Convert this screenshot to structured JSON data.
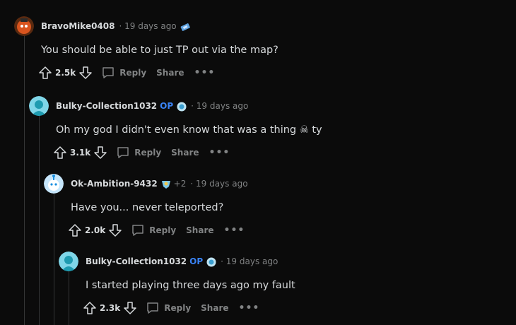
{
  "comments": [
    {
      "author": "BravoMike0408",
      "op_badge": "",
      "extra": "",
      "time": "· 19 days ago",
      "text": "You should be able to just TP out via the map?",
      "score": "2.5k",
      "reply_label": "Reply",
      "share_label": "Share",
      "more_label": "•••",
      "avatar_color": "#c84b1a",
      "flair_icon": "ticket-icon"
    },
    {
      "author": "Bulky-Collection1032",
      "op_badge": "OP",
      "extra": "",
      "time": "· 19 days ago",
      "text": "Oh my god I didn't even know that was a thing ☠ ty",
      "score": "3.1k",
      "reply_label": "Reply",
      "share_label": "Share",
      "more_label": "•••",
      "avatar_color": "#1e9bb0",
      "flair_icon": "crystal-ball-icon"
    },
    {
      "author": "Ok-Ambition-9432",
      "op_badge": "",
      "extra": "+2",
      "time": "· 19 days ago",
      "text": "Have you... never teleported?",
      "score": "2.0k",
      "reply_label": "Reply",
      "share_label": "Share",
      "more_label": "•••",
      "avatar_color": "#1a8fe0",
      "flair_icon": "badge-icon"
    },
    {
      "author": "Bulky-Collection1032",
      "op_badge": "OP",
      "extra": "",
      "time": "· 19 days ago",
      "text": "I started playing three days ago my fault",
      "score": "2.3k",
      "reply_label": "Reply",
      "share_label": "Share",
      "more_label": "•••",
      "avatar_color": "#1e9bb0",
      "flair_icon": "crystal-ball-icon"
    }
  ],
  "colors": {
    "background": "#0b0b0b",
    "text": "#d7dadc",
    "muted": "#818384",
    "op": "#3a83f4",
    "thread_line": "#343536"
  }
}
